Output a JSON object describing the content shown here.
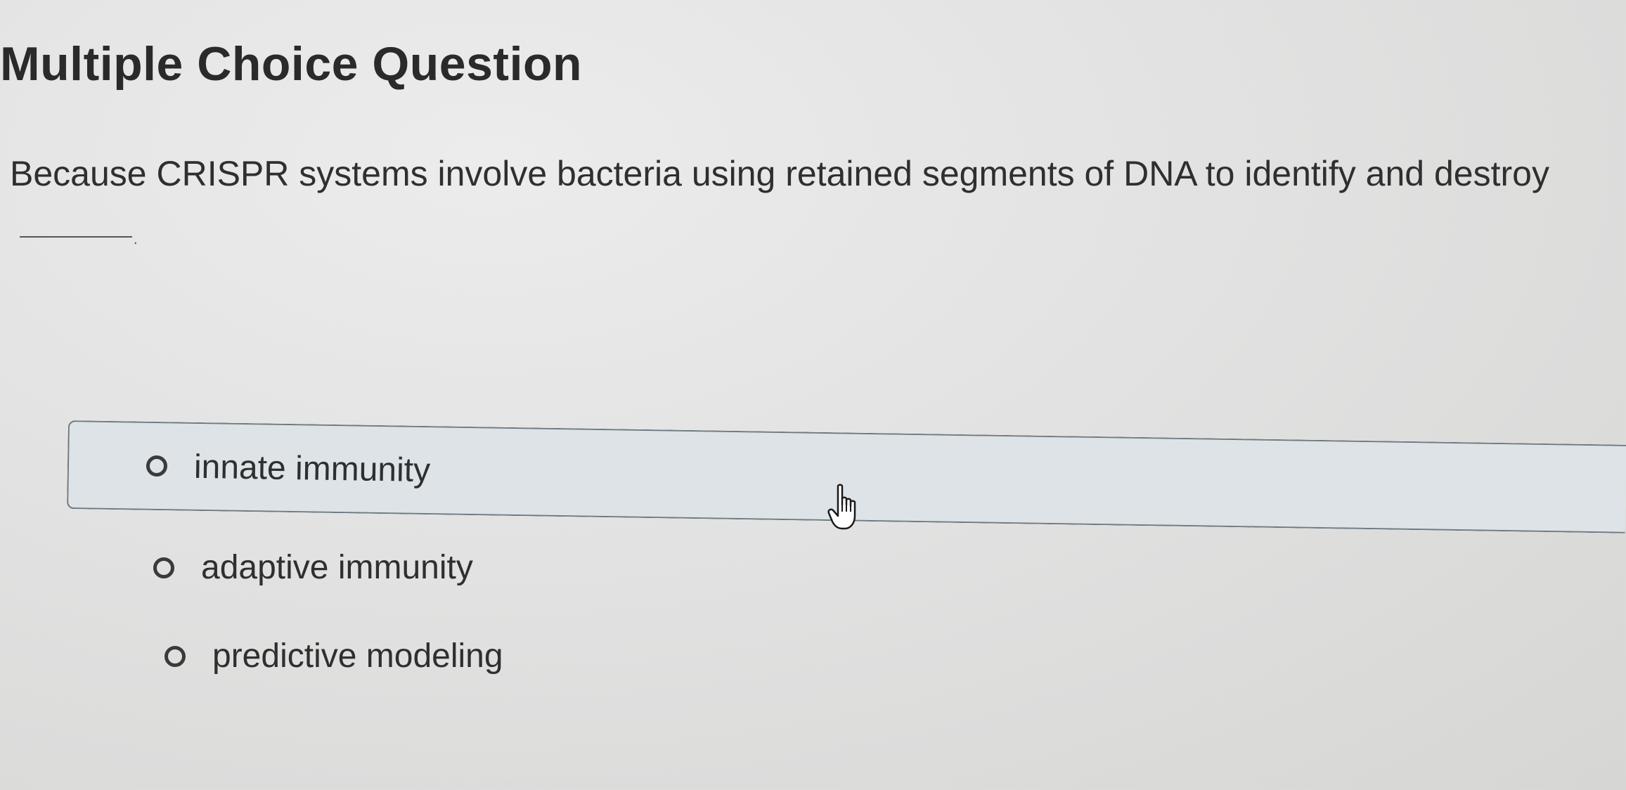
{
  "question": {
    "heading": "Multiple Choice Question",
    "prompt": "Because CRISPR systems involve bacteria using retained segments of DNA to identify and destroy",
    "blank_suffix": "."
  },
  "options": [
    {
      "label": "innate immunity",
      "hovered": true
    },
    {
      "label": "adaptive immunity",
      "hovered": false
    },
    {
      "label": "predictive modeling",
      "hovered": false
    }
  ],
  "icons": {
    "radio": "radio-unchecked-icon",
    "cursor": "hand-pointer-icon"
  },
  "colors": {
    "hover_background": "#dde3e6",
    "hover_border": "#6e7a80",
    "text": "#2f2f2f"
  }
}
